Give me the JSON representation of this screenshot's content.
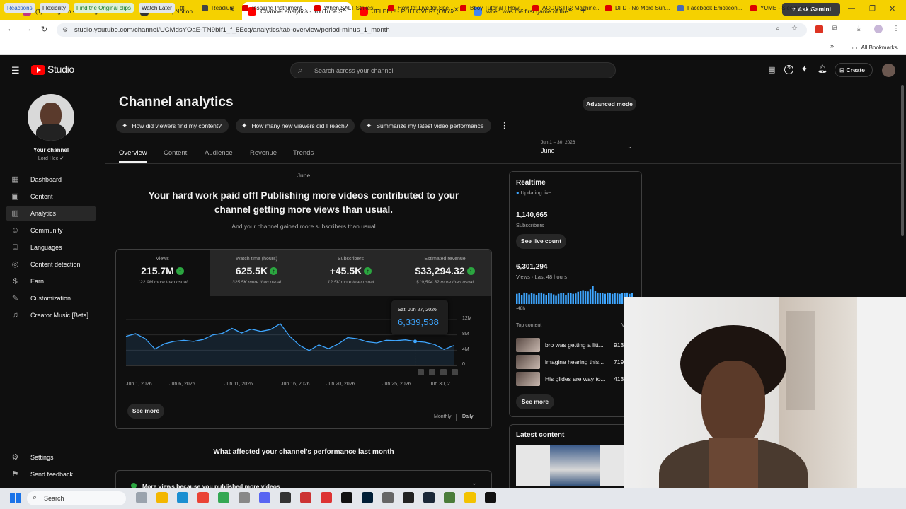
{
  "browser": {
    "tabs": [
      {
        "title": "(1) Instagram • Messages",
        "active": false
      },
      {
        "title": "Shorts | Notion",
        "active": false
      },
      {
        "title": "Channel analytics - YouTube St",
        "active": true
      },
      {
        "title": "JELEEL! - PULLOVER! (Official Vi",
        "active": false
      },
      {
        "title": "when was the first game of the",
        "active": false
      }
    ],
    "new_tab": "+",
    "ask_gemini": "Ask Gemini",
    "url": "studio.youtube.com/channel/UCMdsYOaE-TN9bIf1_f_5Ecg/analytics/tab-overview/period-minus_1_month",
    "bookmarks": [
      "Reactions",
      "Flexibility",
      "Find the Original clips",
      "Watch Later",
      "Readium",
      "Inspiring Instrument...",
      "When SALT Strikes:...",
      "How to: Live for Spe...",
      "Bboy Tutorial I How...",
      "ACOUSTIC: Machine...",
      "DFD - No More Sun...",
      "Facebook Emoticon...",
      "YUME - Sleeping Fo..."
    ],
    "all_bookmarks": "All Bookmarks",
    "colors": {
      "tabstrip": "#f5d100",
      "accent": "#e7a5aa"
    }
  },
  "studio": {
    "logo": "Studio",
    "search_placeholder": "Search across your channel",
    "create_label": "Create",
    "channel": {
      "label": "Your channel",
      "name": "Lord Hec"
    },
    "sidebar": [
      {
        "label": "Dashboard",
        "icon": "dashboard-icon"
      },
      {
        "label": "Content",
        "icon": "content-icon"
      },
      {
        "label": "Analytics",
        "icon": "analytics-icon"
      },
      {
        "label": "Community",
        "icon": "community-icon"
      },
      {
        "label": "Languages",
        "icon": "languages-icon"
      },
      {
        "label": "Content detection",
        "icon": "content-detection-icon"
      },
      {
        "label": "Earn",
        "icon": "earn-icon"
      },
      {
        "label": "Customization",
        "icon": "customization-icon"
      },
      {
        "label": "Creator Music [Beta]",
        "icon": "creator-music-icon"
      }
    ],
    "sidebar_bottom": [
      {
        "label": "Settings",
        "icon": "gear-icon"
      },
      {
        "label": "Send feedback",
        "icon": "feedback-icon"
      }
    ],
    "page_title": "Channel analytics",
    "advanced_mode": "Advanced mode",
    "suggestions": [
      "How did viewers find my content?",
      "How many new viewers did I reach?",
      "Summarize my latest video performance"
    ],
    "tabs": [
      "Overview",
      "Content",
      "Audience",
      "Revenue",
      "Trends"
    ],
    "period": {
      "range": "Jun 1 – 30, 2026",
      "label": "June"
    },
    "overview": {
      "month": "June",
      "headline": "Your hard work paid off! Publishing more videos contributed to your channel getting more views than usual.",
      "subline": "And your channel gained more subscribers than usual",
      "metrics": [
        {
          "label": "Views",
          "value": "215.7M",
          "sub": "122.9M more than usual"
        },
        {
          "label": "Watch time (hours)",
          "value": "625.5K",
          "sub": "325.5K more than usual"
        },
        {
          "label": "Subscribers",
          "value": "+45.5K",
          "sub": "12.5K more than usual"
        },
        {
          "label": "Estimated revenue",
          "value": "$33,294.32",
          "sub": "$19,594.32 more than usual"
        }
      ],
      "tooltip": {
        "date": "Sat, Jun 27, 2026",
        "value": "6,339,538"
      },
      "see_more": "See more",
      "granularity": [
        "Monthly",
        "Daily"
      ],
      "bottom_heading": "What affected your channel's performance last month",
      "bottom_item": "More views because you published more videos"
    },
    "realtime": {
      "title": "Realtime",
      "status": "Updating live",
      "subscribers": "1,140,665",
      "subscribers_label": "Subscribers",
      "see_live_count": "See live count",
      "views": "6,301,294",
      "views_label": "Views · Last 48 hours",
      "axis_label": "-48h",
      "top_content_label": "Top content",
      "top_content_col": "V",
      "top_content": [
        {
          "title": "bro was getting a litt...",
          "views": "913"
        },
        {
          "title": "imagine hearing this...",
          "views": "719"
        },
        {
          "title": "His glides are way to...",
          "views": "413"
        }
      ],
      "see_more": "See more",
      "hourly": [
        0.55,
        0.6,
        0.5,
        0.62,
        0.58,
        0.52,
        0.6,
        0.55,
        0.5,
        0.58,
        0.62,
        0.55,
        0.5,
        0.6,
        0.57,
        0.52,
        0.48,
        0.55,
        0.6,
        0.58,
        0.5,
        0.62,
        0.6,
        0.55,
        0.57,
        0.66,
        0.7,
        0.75,
        0.72,
        0.68,
        0.8,
        1.0,
        0.7,
        0.62,
        0.58,
        0.6,
        0.55,
        0.62,
        0.58,
        0.55,
        0.6,
        0.57,
        0.55,
        0.6,
        0.58,
        0.62,
        0.55,
        0.58
      ]
    },
    "latest_content": "Latest content"
  },
  "chart_data": {
    "type": "line",
    "title": "",
    "x": [
      "Jun 1",
      "Jun 2",
      "Jun 3",
      "Jun 4",
      "Jun 5",
      "Jun 6",
      "Jun 7",
      "Jun 8",
      "Jun 9",
      "Jun 10",
      "Jun 11",
      "Jun 12",
      "Jun 13",
      "Jun 14",
      "Jun 15",
      "Jun 16",
      "Jun 17",
      "Jun 18",
      "Jun 19",
      "Jun 20",
      "Jun 21",
      "Jun 22",
      "Jun 23",
      "Jun 24",
      "Jun 25",
      "Jun 26",
      "Jun 27",
      "Jun 28",
      "Jun 29",
      "Jun 30"
    ],
    "series": [
      {
        "values": [
          7.6,
          8.3,
          7.0,
          4.3,
          5.7,
          6.3,
          6.6,
          6.3,
          6.8,
          8.0,
          8.4,
          9.7,
          8.5,
          9.5,
          8.9,
          9.4,
          10.9,
          7.6,
          5.3,
          3.9,
          5.4,
          4.4,
          5.6,
          7.3,
          7.0,
          6.2,
          5.9,
          6.6,
          6.5,
          6.7,
          6.3,
          6.1,
          5.5,
          4.2,
          5.2
        ]
      }
    ],
    "xtick_labels": [
      "Jun 1, 2026",
      "Jun 6, 2026",
      "Jun 11, 2026",
      "Jun 16, 2026",
      "Jun 20, 2026",
      "Jun 25, 2026",
      "Jun 30, 2..."
    ],
    "ytick_labels": [
      "12M",
      "8M",
      "4M",
      "0"
    ],
    "ylim": [
      0,
      12
    ],
    "unit": "M",
    "grid": true,
    "legend": "none"
  },
  "taskbar": {
    "search": "Search"
  }
}
